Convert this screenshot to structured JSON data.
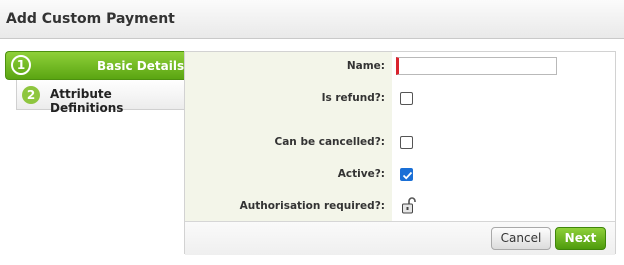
{
  "window": {
    "title": "Add Custom Payment"
  },
  "steps": [
    {
      "number": "1",
      "label": "Basic Details",
      "active": true
    },
    {
      "number": "2",
      "label": "Attribute Definitions",
      "active": false
    }
  ],
  "form": {
    "name_label": "Name:",
    "name_value": "",
    "is_refund_label": "Is refund?:",
    "is_refund_checked": false,
    "can_be_cancelled_label": "Can be cancelled?:",
    "can_be_cancelled_checked": false,
    "active_label": "Active?:",
    "active_checked": true,
    "authorisation_required_label": "Authorisation required?:",
    "authorisation_required_state": "unlocked"
  },
  "buttons": {
    "cancel_label": "Cancel",
    "next_label": "Next"
  },
  "colors": {
    "accent_green": "#5aa512",
    "required_red": "#d9232d",
    "checkbox_blue": "#1a6fd6"
  },
  "icons": {
    "lock": "padlock-unlocked-icon",
    "check": "checkmark-icon"
  }
}
